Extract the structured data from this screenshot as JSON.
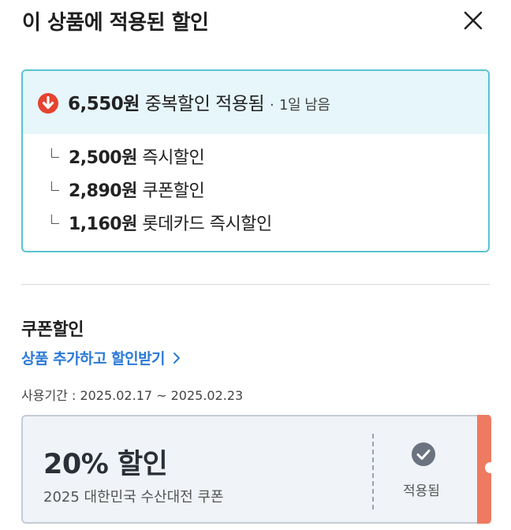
{
  "header": {
    "title": "이 상품에 적용된 할인",
    "close_icon": "close-icon"
  },
  "summary": {
    "amount": "6,550원",
    "label": "중복할인 적용됨",
    "separator": "·",
    "days_left": "1일 남음",
    "icon": "down-arrow-circle-icon",
    "icon_color": "#e5432f",
    "items": [
      {
        "amount": "2,500원",
        "label": "즉시할인"
      },
      {
        "amount": "2,890원",
        "label": "쿠폰할인"
      },
      {
        "amount": "1,160원",
        "label": "롯데카드 즉시할인"
      }
    ],
    "border_color": "#5cc2cf",
    "head_bg": "#e6f6fb"
  },
  "coupon_section": {
    "title": "쿠폰할인",
    "add_link": "상품 추가하고 할인받기",
    "add_link_color": "#2a7ad6",
    "period": "사용기간 : 2025.02.17 ~ 2025.02.23",
    "coupon": {
      "title": "20% 할인",
      "description": "2025 대한민국 수산대전 쿠폰",
      "status": "적용됨",
      "status_icon": "check-circle-icon",
      "stripe_color": "#ef7a62"
    }
  }
}
